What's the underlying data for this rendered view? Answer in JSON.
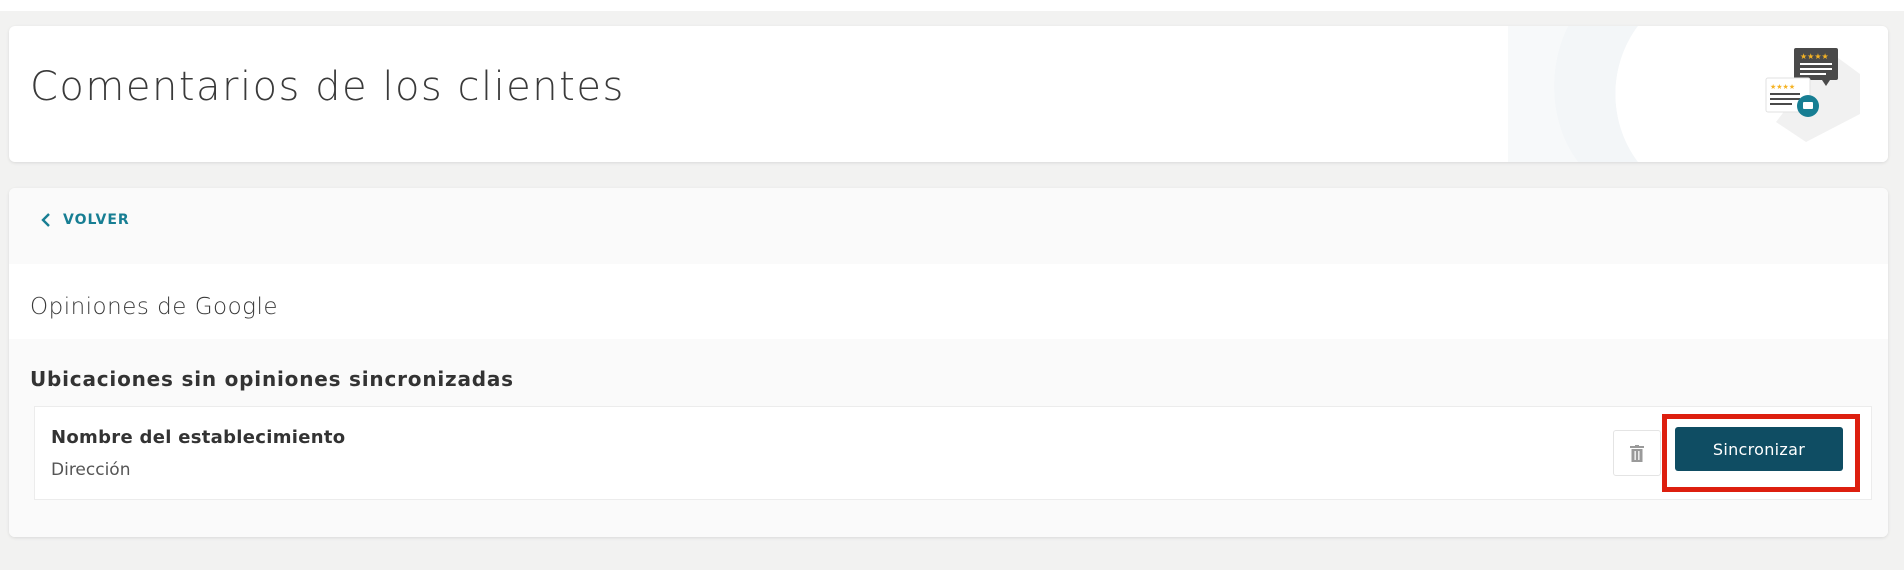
{
  "header": {
    "title": "Comentarios de los clientes",
    "illustration_icon": "customer-reviews-illustration",
    "accent_color": "#177e93"
  },
  "nav": {
    "back_label": "VOLVER",
    "back_icon": "chevron-left-icon"
  },
  "section": {
    "title": "Opiniones de Google"
  },
  "group": {
    "heading": "Ubicaciones sin opiniones sincronizadas",
    "locations": [
      {
        "name": "Nombre del establecimiento",
        "address": "Dirección",
        "delete_icon": "trash-icon",
        "action_label": "Sincronizar"
      }
    ]
  },
  "colors": {
    "primary_button": "#0f4d63",
    "highlight": "#dd1f0f",
    "link": "#177e93"
  }
}
